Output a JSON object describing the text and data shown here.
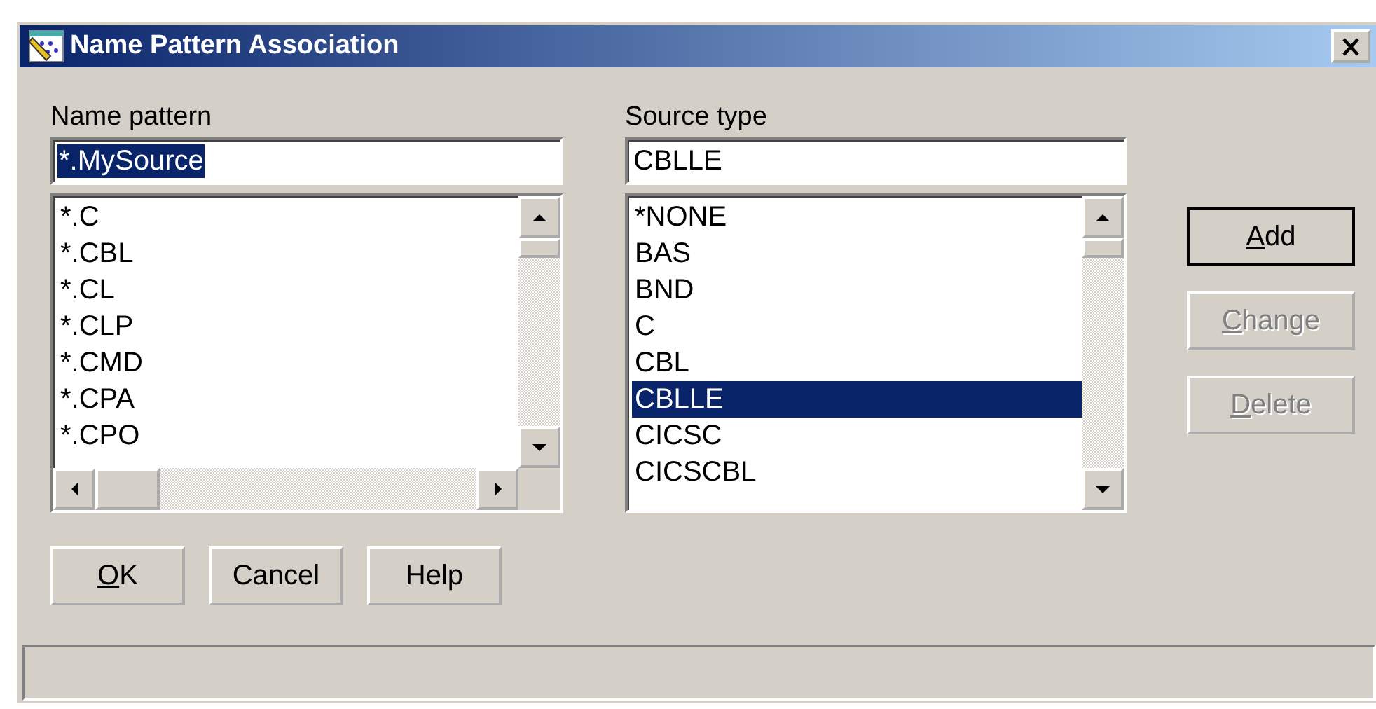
{
  "window": {
    "title": "Name Pattern Association"
  },
  "name_pattern": {
    "label": "Name pattern",
    "value": "*.MySource",
    "value_selected": true,
    "items": [
      {
        "text": "*.C",
        "selected": false
      },
      {
        "text": "*.CBL",
        "selected": false
      },
      {
        "text": "*.CL",
        "selected": false
      },
      {
        "text": "*.CLP",
        "selected": false
      },
      {
        "text": "*.CMD",
        "selected": false
      },
      {
        "text": "*.CPA",
        "selected": false
      },
      {
        "text": "*.CPO",
        "selected": false
      }
    ]
  },
  "source_type": {
    "label": "Source type",
    "value": "CBLLE",
    "value_selected": false,
    "items": [
      {
        "text": "*NONE",
        "selected": false
      },
      {
        "text": "BAS",
        "selected": false
      },
      {
        "text": "BND",
        "selected": false
      },
      {
        "text": "C",
        "selected": false
      },
      {
        "text": "CBL",
        "selected": false
      },
      {
        "text": "CBLLE",
        "selected": true
      },
      {
        "text": "CICSC",
        "selected": false
      },
      {
        "text": "CICSCBL",
        "selected": false
      }
    ]
  },
  "side_buttons": [
    {
      "label": "Add",
      "mnemonic": true,
      "disabled": false,
      "default": true
    },
    {
      "label": "Change",
      "mnemonic": true,
      "disabled": true,
      "default": false
    },
    {
      "label": "Delete",
      "mnemonic": true,
      "disabled": true,
      "default": false
    }
  ],
  "bottom_buttons": [
    {
      "label": "OK",
      "mnemonic": true,
      "disabled": false,
      "default": false
    },
    {
      "label": "Cancel",
      "mnemonic": false,
      "disabled": false,
      "default": false
    },
    {
      "label": "Help",
      "mnemonic": false,
      "disabled": false,
      "default": false
    }
  ]
}
